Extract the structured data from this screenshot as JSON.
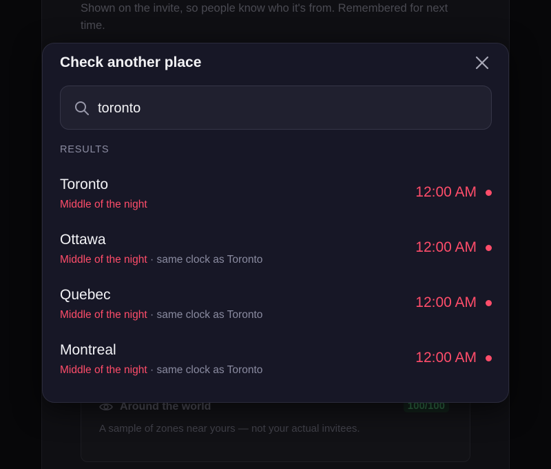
{
  "background": {
    "hint_text": "Shown on the invite, so people know who it's from. Remembered for next time.",
    "card": {
      "title": "Around the world",
      "score": "100/100",
      "subtitle": "A sample of zones near yours — not your actual invitees."
    }
  },
  "modal": {
    "title": "Check another place",
    "search": {
      "value": "toronto",
      "placeholder": ""
    },
    "results_label": "RESULTS",
    "results": [
      {
        "city": "Toronto",
        "status": "Middle of the night",
        "extra": "",
        "time": "12:00 AM"
      },
      {
        "city": "Ottawa",
        "status": "Middle of the night",
        "extra": " · same clock as Toronto",
        "time": "12:00 AM"
      },
      {
        "city": "Quebec",
        "status": "Middle of the night",
        "extra": " · same clock as Toronto",
        "time": "12:00 AM"
      },
      {
        "city": "Montreal",
        "status": "Middle of the night",
        "extra": " · same clock as Toronto",
        "time": "12:00 AM"
      }
    ]
  },
  "colors": {
    "accent_red": "#ff4d6a",
    "modal_bg": "#171726"
  },
  "icons": {
    "close": "close-icon",
    "search": "search-icon",
    "eye": "eye-icon"
  }
}
